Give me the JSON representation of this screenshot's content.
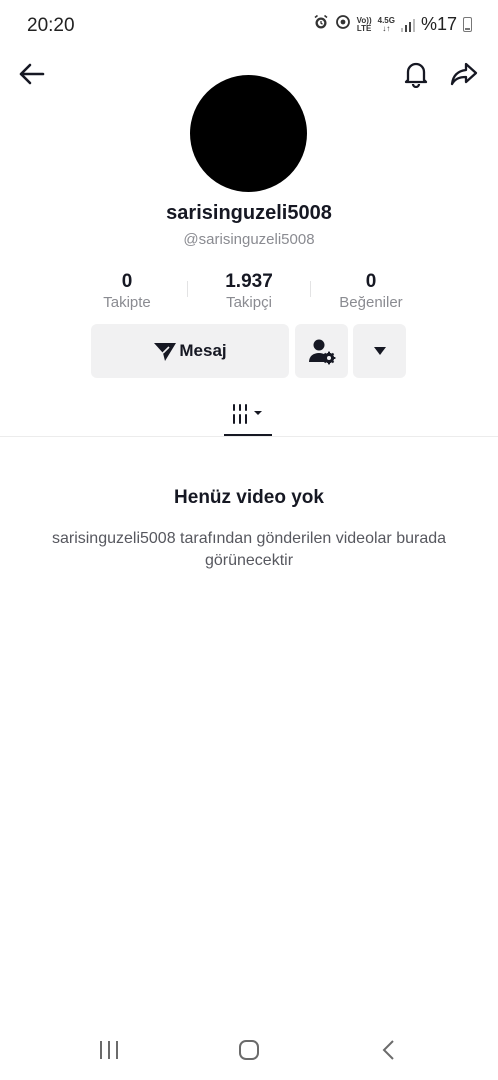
{
  "status_bar": {
    "time": "20:20",
    "network_top": "Vo))",
    "network_bottom": "LTE",
    "speed_top": "4.5G",
    "speed_bottom": "↓↑",
    "battery": "%17"
  },
  "nav": {
    "back_icon": "arrow-left-icon",
    "bell_icon": "bell-icon",
    "share_icon": "share-icon"
  },
  "profile": {
    "username": "sarisinguzeli5008",
    "handle": "@sarisinguzeli5008",
    "stats": [
      {
        "value": "0",
        "label": "Takipte"
      },
      {
        "value": "1.937",
        "label": "Takipçi"
      },
      {
        "value": "0",
        "label": "Beğeniler"
      }
    ]
  },
  "actions": {
    "message_label": "Mesaj"
  },
  "empty_state": {
    "title": "Henüz video yok",
    "description": "sarisinguzeli5008 tarafından gönderilen videolar burada görünecektir"
  },
  "colors": {
    "primary_text": "#161823",
    "secondary_text": "#8a8b91",
    "button_bg": "#f1f1f2"
  }
}
